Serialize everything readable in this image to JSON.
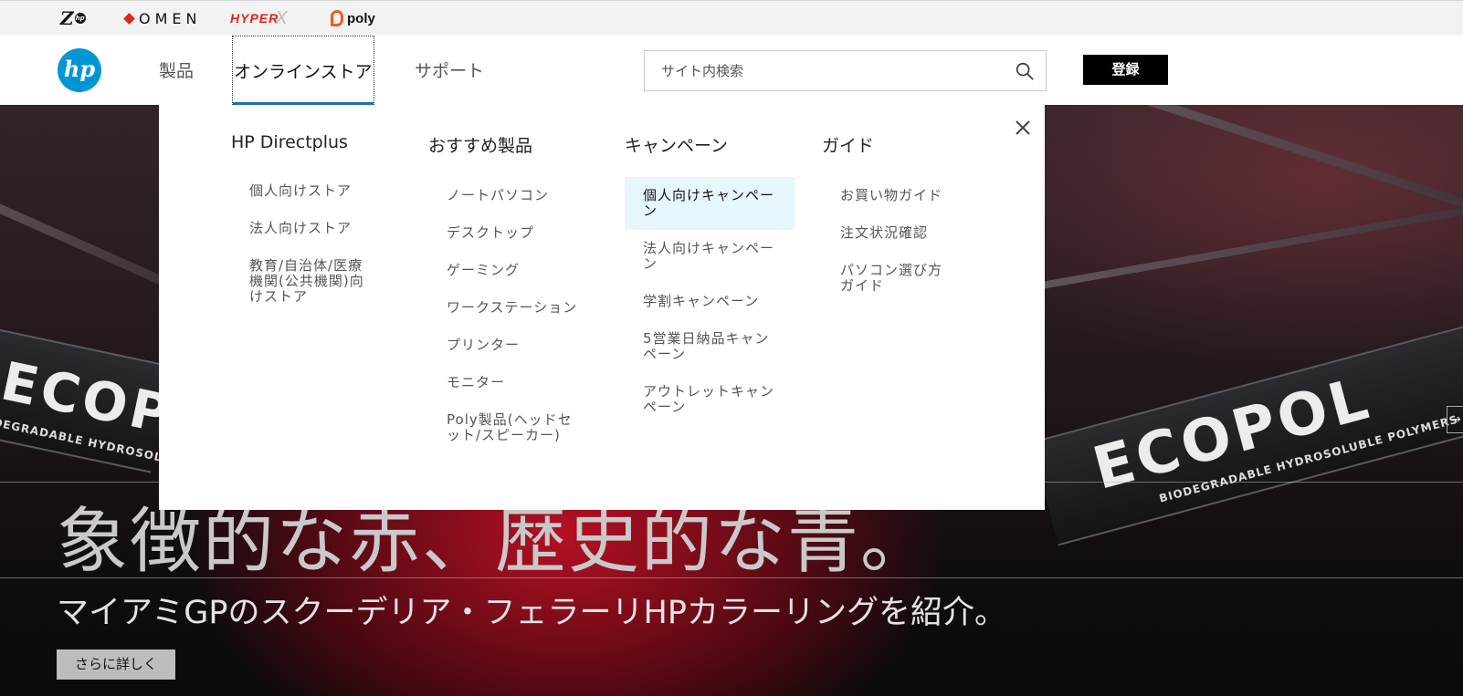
{
  "brands": {
    "z": "Z",
    "z_sub": "hp",
    "omen": "OMEN",
    "hyperx": "HYPER",
    "hyperx_x": "X",
    "poly": "poly"
  },
  "header": {
    "logo": "hp",
    "nav": [
      "製品",
      "オンラインストア",
      "サポート"
    ],
    "search_placeholder": "サイト内検索",
    "register": "登録"
  },
  "mega_menu": {
    "columns": [
      {
        "title": "HP Directplus",
        "items": [
          "個人向けストア",
          "法人向けストア",
          "教育/自治体/医療機関(公共機関)向けストア"
        ]
      },
      {
        "title": "おすすめ製品",
        "items": [
          "ノートパソコン",
          "デスクトップ",
          "ゲーミング",
          "ワークステーション",
          "プリンター",
          "モニター",
          "Poly製品(ヘッドセット/スピーカー)"
        ]
      },
      {
        "title": "キャンペーン",
        "items": [
          "個人向けキャンペーン",
          "法人向けキャンペーン",
          "学割キャンペーン",
          "5営業日納品キャンペーン",
          "アウトレットキャンペーン"
        ]
      },
      {
        "title": "ガイド",
        "items": [
          "お買い物ガイド",
          "注文状況確認",
          "パソコン選び方ガイド"
        ]
      }
    ],
    "active_item": "個人向けキャンペーン"
  },
  "hero": {
    "banner_left": "ECOPOL",
    "banner_left_sub": "DEGRADABLE HYDROSOLUBLE P",
    "banner_right": "ECOPOL",
    "banner_right_sub": "BIODEGRADABLE HYDROSOLUBLE POLYMERS",
    "title": "象徴的な赤、歴史的な青。",
    "subtitle": "マイアミGPのスクーデリア・フェラーリHPカラーリングを紹介。",
    "cta": "さらに詳しく"
  },
  "colors": {
    "hp_blue": "#0096d6",
    "nav_underline": "#1a6fb4",
    "active_bg": "#e6f7fb",
    "register_bg": "#000000"
  }
}
